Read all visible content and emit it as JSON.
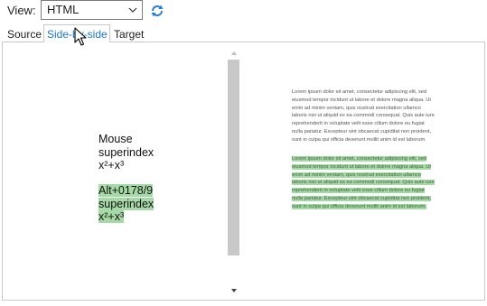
{
  "toolbar": {
    "view_label": "View:",
    "view_value": "HTML",
    "icons": {
      "dropdown": "chevron-down-icon",
      "refresh": "refresh-icon"
    }
  },
  "tabs": [
    {
      "label": "Source"
    },
    {
      "label": "Side-by-side",
      "active": true
    },
    {
      "label": "Target"
    }
  ],
  "source": {
    "block1": [
      "Mouse",
      "superindex",
      "x²+x³"
    ],
    "block2": [
      "Alt+0178/9",
      "superindex",
      "x²+x³"
    ]
  },
  "preview": {
    "paragraph": "Lorem ipsum dolor sit amet, consectetur adipiscing elit, sed eiusmod tempor incidunt ut labore et dolore magna aliqua. Ut enim ad minim veniam, quis nostrud exercitation ullamco laboris nisi ut aliquid ex ea commodi consequat. Quis aute iure reprehenderit in voluptate velit esse cillum dolore eu fugiat nulla pariatur. Excepteur sint obcaecat cupiditat non proident, sunt in culpa qui officia deserunt mollit anim id est laborum.",
    "highlighted_paragraph": "Lorem ipsum dolor sit amet, consectetur adipiscing elit, sed eiusmod tempor incidunt ut labore et dolore magna aliqua. Ut enim ad minim veniam, quis nostrud exercitation ullamco laboris nisi ut aliquid ex ea commodi consequat. Quis aute iure reprehenderit in voluptate velit esse cillum dolore eu fugiat nulla pariatur. Excepteur sint obcaecat cupiditat non proident, sunt in culpa qui officia deserunt mollit anim id est laborum."
  },
  "colors": {
    "active_tab": "#1a77c9",
    "highlight": "#a6d9a6",
    "scrollbar": "#c8c8c8"
  }
}
